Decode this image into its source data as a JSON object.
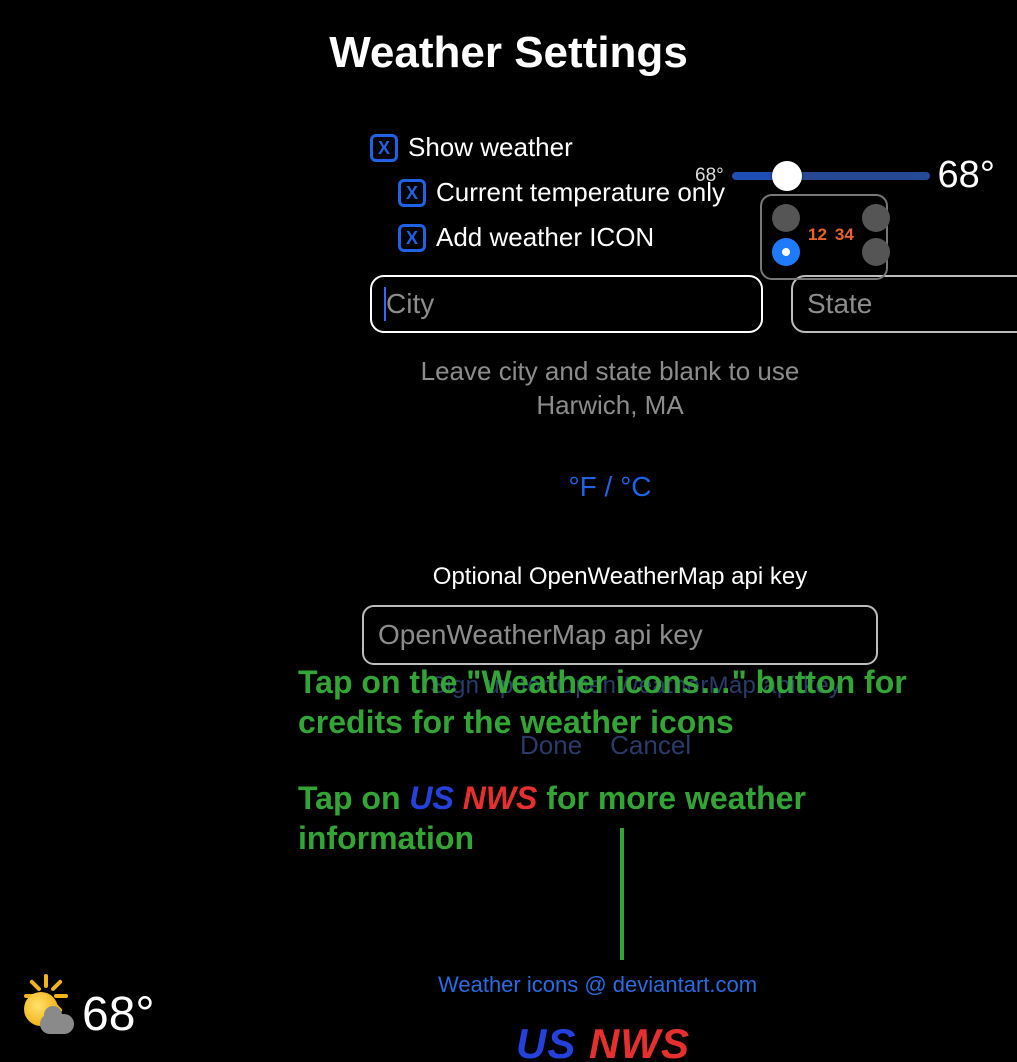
{
  "title": "Weather Settings",
  "checkboxes": {
    "show_weather": {
      "label": "Show weather",
      "checked": true
    },
    "current_temp_only": {
      "label": "Current temperature only",
      "checked": true
    },
    "add_weather_icon": {
      "label": "Add weather ICON",
      "checked": true
    }
  },
  "slider": {
    "min_label": "68°",
    "max_label": "68°",
    "value_percent": 28
  },
  "position_picker": {
    "labels": [
      "12",
      "34"
    ],
    "selected": "bottom-left"
  },
  "inputs": {
    "city": {
      "value": "",
      "placeholder": "City"
    },
    "state": {
      "value": "",
      "placeholder": "State"
    }
  },
  "hint": "Leave city and state blank to use Harwich, MA",
  "unit_toggle": "°F / °C",
  "api": {
    "label": "Optional OpenWeatherMap api key",
    "placeholder": "OpenWeatherMap api key",
    "value": ""
  },
  "faded": {
    "signup_link": "Sign up for OpenWeatherMap api key",
    "done": "Done",
    "cancel": "Cancel"
  },
  "overlays": {
    "note1_pre": "Tap on the \"Weather icons…\" button for credits for the weather icons",
    "note2_pre": "Tap on ",
    "note2_us": "US",
    "note2_nws": "NWS",
    "note2_post": " for more weather information"
  },
  "credits_link": "Weather icons @  deviantart.com",
  "usnws": {
    "us": "US",
    "nws": "NWS"
  },
  "preview_temp": "68°"
}
